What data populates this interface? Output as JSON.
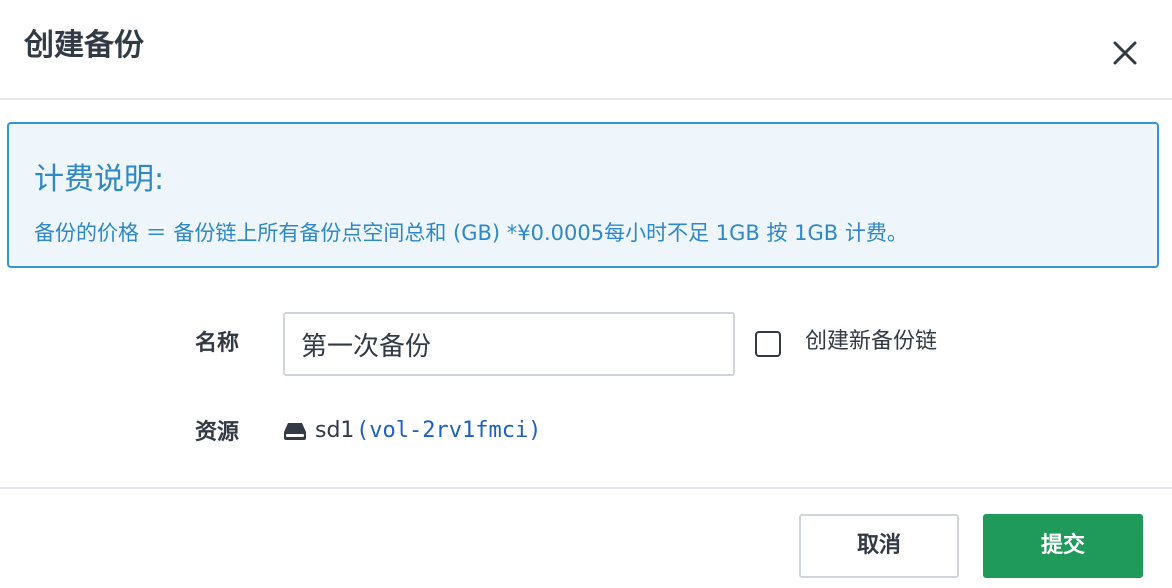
{
  "dialog": {
    "title": "创建备份",
    "close_icon": "close-icon"
  },
  "notice": {
    "title": "计费说明:",
    "text": "备份的价格 ＝ 备份链上所有备份点空间总和 (GB) *¥0.0005每小时不足 1GB 按 1GB 计费。",
    "color": "#2f88c6",
    "border_color": "#3395d1"
  },
  "form": {
    "name_label": "名称",
    "name_value": "第一次备份",
    "new_chain_label": "创建新备份链",
    "new_chain_checked": false,
    "resource_label": "资源",
    "resource_icon": "disk-icon",
    "resource_name": "sd1",
    "resource_id": "(vol-2rv1fmci)"
  },
  "footer": {
    "cancel_label": "取消",
    "submit_label": "提交",
    "submit_color": "#1f9a5b"
  }
}
